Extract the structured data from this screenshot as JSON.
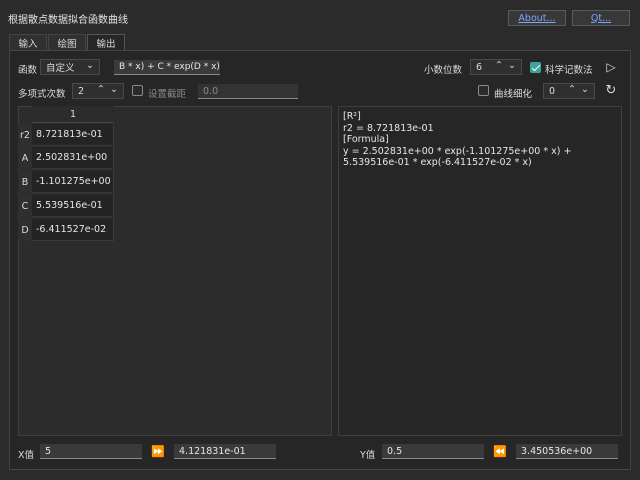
{
  "window": {
    "title": "根据散点数据拟合函数曲线",
    "about_label": "About...",
    "qt_label": "Qt..."
  },
  "tabs": [
    {
      "label": "输入"
    },
    {
      "label": "绘图"
    },
    {
      "label": "输出"
    }
  ],
  "row1": {
    "func_label": "函数",
    "func_type": "自定义",
    "formula": "B * x) + C * exp(D * x)",
    "decimals_label": "小数位数",
    "decimals_value": "6",
    "sci_label": "科学记数法"
  },
  "row2": {
    "poly_label": "多项式次数",
    "poly_value": "2",
    "intercept_label": "设置截距",
    "intercept_value": "0.0",
    "smooth_label": "曲线细化",
    "smooth_value": "0"
  },
  "table": {
    "column_header": "1",
    "rows": [
      {
        "label": "r2",
        "value": "8.721813e-01"
      },
      {
        "label": "A",
        "value": "2.502831e+00"
      },
      {
        "label": "B",
        "value": "-1.101275e+00"
      },
      {
        "label": "C",
        "value": "5.539516e-01"
      },
      {
        "label": "D",
        "value": "-6.411527e-02"
      }
    ]
  },
  "output_text": "[R²]\nr2 = 8.721813e-01\n[Formula]\ny = 2.502831e+00 * exp(-1.101275e+00 * x) +\n5.539516e-01 * exp(-6.411527e-02 * x)",
  "bottom": {
    "x_label": "X值",
    "x_value": "5",
    "x_result": "4.121831e-01",
    "y_label": "Y值",
    "y_value": "0.5",
    "y_result": "3.450536e+00"
  }
}
